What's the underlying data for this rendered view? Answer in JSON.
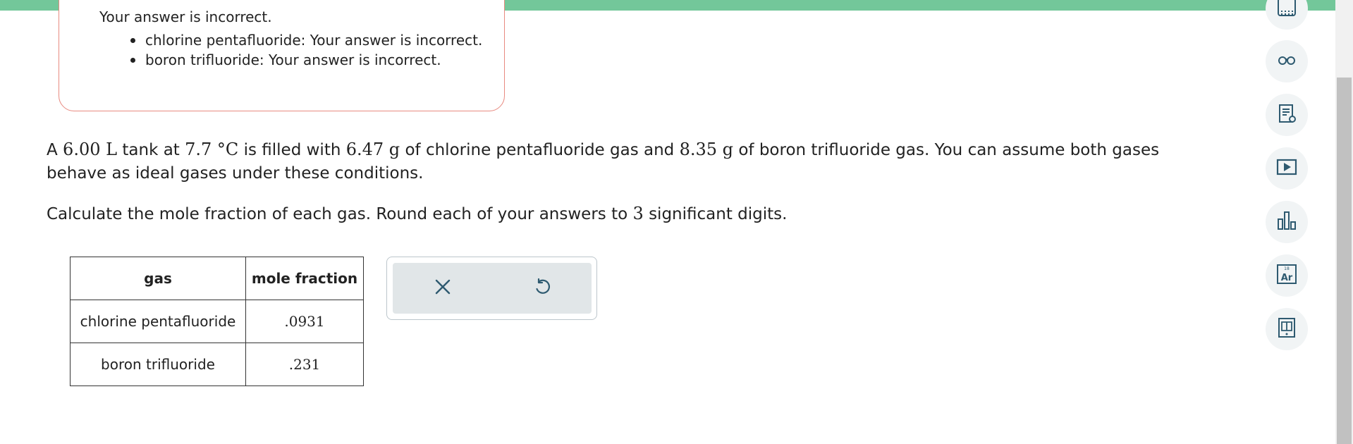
{
  "feedback": {
    "heading": "Your answer is incorrect.",
    "items": [
      "chlorine pentafluoride: Your answer is incorrect.",
      "boron trifluoride: Your answer is incorrect."
    ]
  },
  "problem": {
    "p1": "A ",
    "volume": "6.00 L",
    "p2": " tank at ",
    "temp": "7.7 °C",
    "p3": " is filled with ",
    "mass1": "6.47 g",
    "p4": " of chlorine pentafluoride gas and ",
    "mass2": "8.35 g",
    "p5": " of boron trifluoride gas. You can assume both gases behave as ideal gases under these conditions."
  },
  "instructions": {
    "pre": "Calculate the mole fraction of each gas. Round each of your answers to ",
    "digits": "3",
    "post": " significant digits."
  },
  "table": {
    "headers": [
      "gas",
      "mole fraction"
    ],
    "rows": [
      {
        "gas": "chlorine pentafluoride",
        "value": ".0931"
      },
      {
        "gas": "boron trifluoride",
        "value": ".231"
      }
    ]
  },
  "toolbox": {
    "clear_icon": "x-icon",
    "undo_icon": "undo-icon"
  },
  "side_tools": [
    "calculator-icon",
    "glasses-icon",
    "notes-icon",
    "video-icon",
    "chart-icon",
    "periodic-table-icon",
    "textbook-icon"
  ],
  "colors": {
    "top_bar": "#73c79a",
    "feedback_border": "#e88a80",
    "icon": "#2e5a70"
  }
}
